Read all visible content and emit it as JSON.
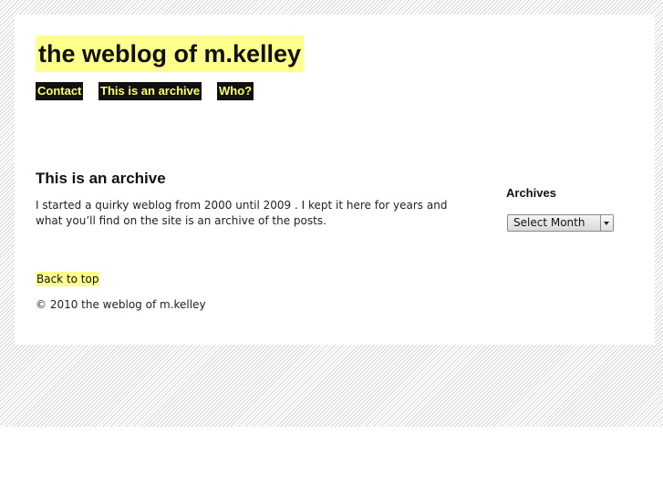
{
  "site": {
    "title": "the weblog of m.kelley"
  },
  "nav": {
    "items": [
      {
        "label": "Contact"
      },
      {
        "label": "This is an archive"
      },
      {
        "label": "Who?"
      }
    ]
  },
  "post": {
    "title": "This is an archive",
    "body": "I started a quirky weblog from 2000 until 2009 . I kept it here for years and what you’ll find on the site is an archive of the posts."
  },
  "sidebar": {
    "archives_title": "Archives",
    "select_value": "Select Month"
  },
  "footer": {
    "back_to_top": "Back to top",
    "copyright": "© 2010 the weblog of m.kelley"
  },
  "colors": {
    "highlight": "#ffff8c",
    "nav_bg": "#111111",
    "nav_text": "#ffff66"
  }
}
